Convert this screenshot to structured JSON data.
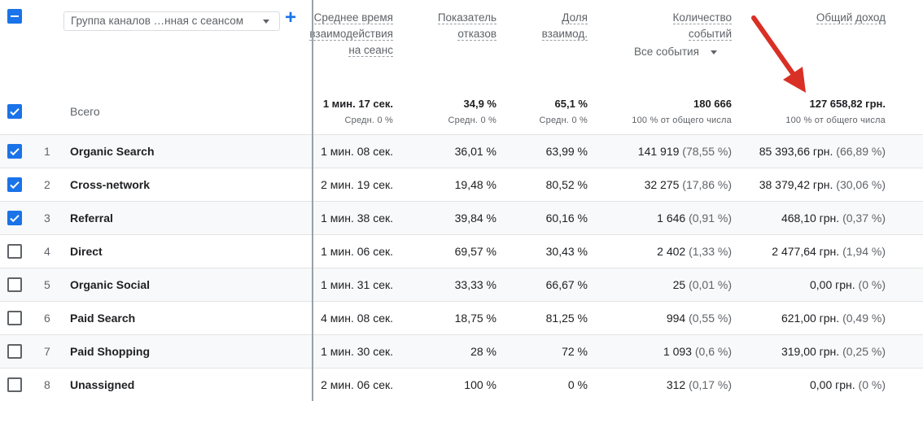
{
  "header": {
    "dimension_dropdown": "Группа каналов …нная с сеансом",
    "add_label": "+",
    "columns": [
      {
        "lines": [
          "Среднее время",
          "взаимодействия",
          "на сеанс"
        ]
      },
      {
        "lines": [
          "Показатель",
          "отказов"
        ]
      },
      {
        "lines": [
          "Доля",
          "взаимод."
        ]
      },
      {
        "lines": [
          "Количество",
          "событий"
        ]
      },
      {
        "lines": [
          "Общий доход"
        ]
      }
    ],
    "events_selector": "Все события"
  },
  "totals": {
    "label": "Всего",
    "values": [
      "1 мин. 17 сек.",
      "34,9 %",
      "65,1 %",
      "180 666",
      "127 658,82 грн."
    ],
    "subs": [
      "Средн. 0 %",
      "Средн. 0 %",
      "Средн. 0 %",
      "100 % от общего числа",
      "100 % от общего числа"
    ]
  },
  "rows": [
    {
      "checked": true,
      "num": "1",
      "name": "Organic Search",
      "time": "1 мин. 08 сек.",
      "bounce": "36,01 %",
      "engaged": "63,99 %",
      "events": "141 919",
      "events_pct": "(78,55 %)",
      "revenue": "85 393,66 грн.",
      "revenue_pct": "(66,89 %)"
    },
    {
      "checked": true,
      "num": "2",
      "name": "Cross-network",
      "time": "2 мин. 19 сек.",
      "bounce": "19,48 %",
      "engaged": "80,52 %",
      "events": "32 275",
      "events_pct": "(17,86 %)",
      "revenue": "38 379,42 грн.",
      "revenue_pct": "(30,06 %)"
    },
    {
      "checked": true,
      "num": "3",
      "name": "Referral",
      "time": "1 мин. 38 сек.",
      "bounce": "39,84 %",
      "engaged": "60,16 %",
      "events": "1 646",
      "events_pct": "(0,91 %)",
      "revenue": "468,10 грн.",
      "revenue_pct": "(0,37 %)"
    },
    {
      "checked": false,
      "num": "4",
      "name": "Direct",
      "time": "1 мин. 06 сек.",
      "bounce": "69,57 %",
      "engaged": "30,43 %",
      "events": "2 402",
      "events_pct": "(1,33 %)",
      "revenue": "2 477,64 грн.",
      "revenue_pct": "(1,94 %)"
    },
    {
      "checked": false,
      "num": "5",
      "name": "Organic Social",
      "time": "1 мин. 31 сек.",
      "bounce": "33,33 %",
      "engaged": "66,67 %",
      "events": "25",
      "events_pct": "(0,01 %)",
      "revenue": "0,00 грн.",
      "revenue_pct": "(0 %)"
    },
    {
      "checked": false,
      "num": "6",
      "name": "Paid Search",
      "time": "4 мин. 08 сек.",
      "bounce": "18,75 %",
      "engaged": "81,25 %",
      "events": "994",
      "events_pct": "(0,55 %)",
      "revenue": "621,00 грн.",
      "revenue_pct": "(0,49 %)"
    },
    {
      "checked": false,
      "num": "7",
      "name": "Paid Shopping",
      "time": "1 мин. 30 сек.",
      "bounce": "28 %",
      "engaged": "72 %",
      "events": "1 093",
      "events_pct": "(0,6 %)",
      "revenue": "319,00 грн.",
      "revenue_pct": "(0,25 %)"
    },
    {
      "checked": false,
      "num": "8",
      "name": "Unassigned",
      "time": "2 мин. 06 сек.",
      "bounce": "100 %",
      "engaged": "0 %",
      "events": "312",
      "events_pct": "(0,17 %)",
      "revenue": "0,00 грн.",
      "revenue_pct": "(0 %)"
    }
  ],
  "colors": {
    "accent": "#1a73e8",
    "annotation_arrow": "#d93025"
  }
}
